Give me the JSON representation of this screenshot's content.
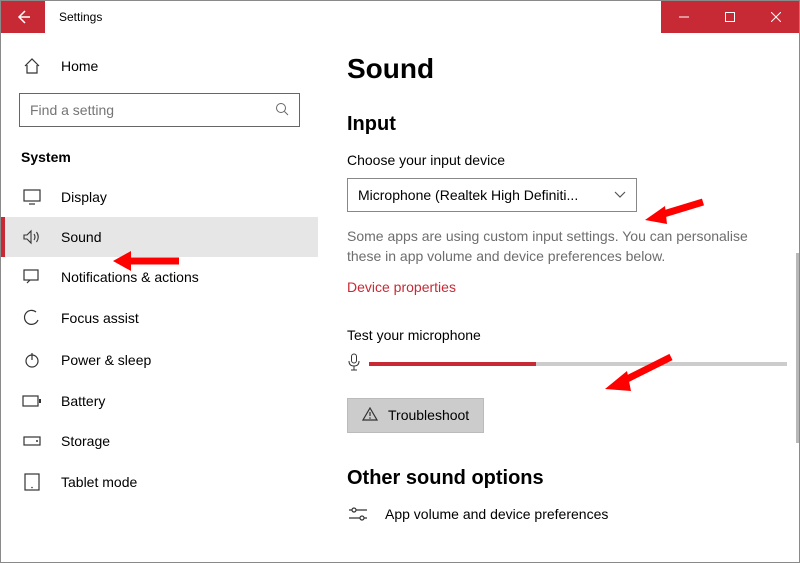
{
  "titlebar": {
    "title": "Settings"
  },
  "sidebar": {
    "home_label": "Home",
    "search_placeholder": "Find a setting",
    "category_label": "System",
    "items": [
      {
        "label": "Display"
      },
      {
        "label": "Sound"
      },
      {
        "label": "Notifications & actions"
      },
      {
        "label": "Focus assist"
      },
      {
        "label": "Power & sleep"
      },
      {
        "label": "Battery"
      },
      {
        "label": "Storage"
      },
      {
        "label": "Tablet mode"
      }
    ]
  },
  "main": {
    "page_title": "Sound",
    "input_section_title": "Input",
    "input_label": "Choose your input device",
    "input_dropdown_value": "Microphone (Realtek High Definiti...",
    "input_hint": "Some apps are using custom input settings. You can personalise these in app volume and device preferences below.",
    "device_properties_link": "Device properties",
    "test_mic_label": "Test your microphone",
    "troubleshoot_label": "Troubleshoot",
    "other_section_title": "Other sound options",
    "option_app_volume": "App volume and device preferences"
  },
  "colors": {
    "accent": "#c72a35"
  }
}
